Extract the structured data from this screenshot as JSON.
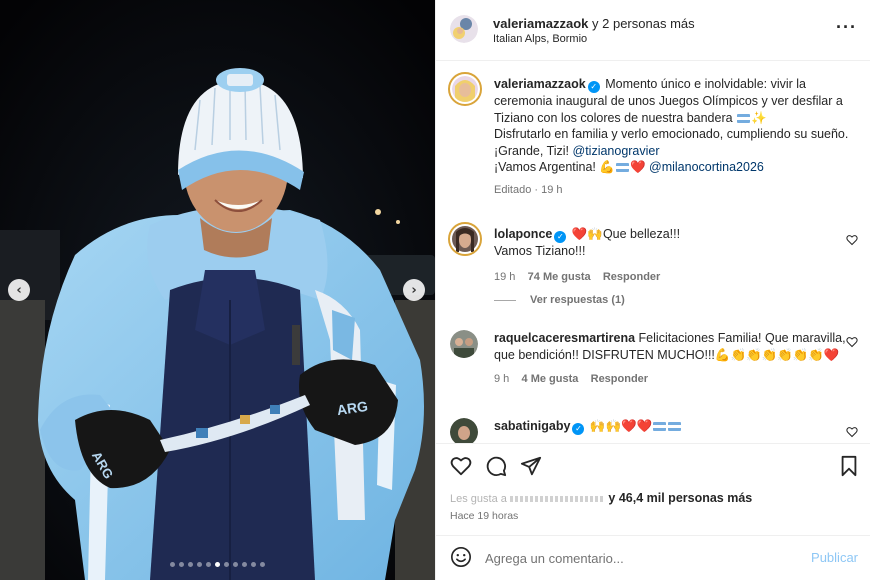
{
  "post": {
    "header_user": "valeriamazzaok",
    "header_rest": " y 2 personas más",
    "location": "Italian Alps, Bormio",
    "more_icon": "more-horizontal-icon"
  },
  "caption": {
    "username": "valeriamazzaok",
    "line1": "Momento único e inolvidable: vivir la ceremonia inaugural de unos Juegos Olímpicos y ver desfilar a Tiziano con los colores de nuestra bandera",
    "line1_emoji": "✨",
    "line2": "Disfrutarlo en familia y verlo emocionado, cumpliendo su sueño.",
    "line3_prefix": "¡Grande, Tizi! ",
    "line3_mention": "@tizianogravier",
    "line4_prefix": "¡Vamos Argentina! ",
    "line4_emoji": "💪",
    "line4_emoji2": "❤️",
    "line4_mention": "@milanocortina2026",
    "meta": "Editado · 19 h"
  },
  "comments": [
    {
      "username": "lolaponce",
      "text": "❤️🙌Que belleza!!!",
      "text2": "Vamos Tiziano!!!",
      "time": "19 h",
      "likes": "74 Me gusta",
      "reply": "Responder",
      "view_replies": "Ver respuestas (1)"
    },
    {
      "username": "raquelcaceresmartirena",
      "text": "Felicitaciones Familia! Que maravilla, que bendición!! DISFRUTEN MUCHO!!!💪👏👏👏👏👏👏❤️",
      "time": "9 h",
      "likes": "4 Me gusta",
      "reply": "Responder"
    },
    {
      "username": "sabatinigaby",
      "text": "🙌🙌❤️❤️"
    }
  ],
  "actions": {
    "likes_prefix": "Les gusta a ",
    "likes_text": "y 46,4 mil personas más",
    "time_ago": "Hace 19 horas"
  },
  "comment_box": {
    "placeholder": "Agrega un comentario...",
    "publish": "Publicar"
  },
  "media": {
    "prev": "‹",
    "next": "›",
    "slide_count": 11,
    "active_slide": 5,
    "sleeve_text_left": "ARG",
    "sleeve_text_right": "ARG"
  },
  "colors": {
    "accent_link": "#00376b",
    "verified": "#0095f6",
    "publish_disabled": "#8ec7f5",
    "jacket": "#8fc8ec",
    "sweater": "#1f2a52"
  }
}
